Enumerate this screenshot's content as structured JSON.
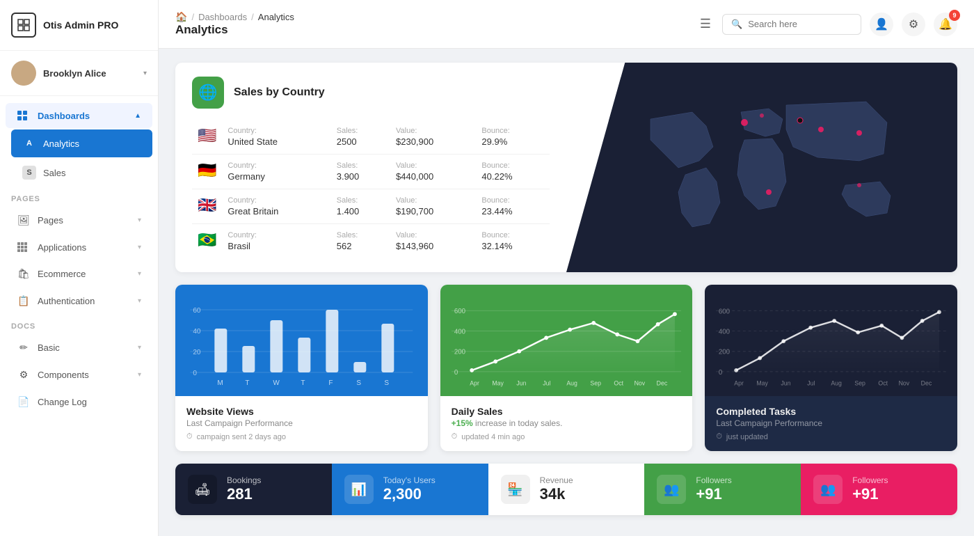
{
  "app": {
    "name": "Otis Admin PRO"
  },
  "user": {
    "name": "Brooklyn Alice"
  },
  "sidebar": {
    "pages_label": "PAGES",
    "docs_label": "DOCS",
    "items": [
      {
        "id": "dashboards",
        "label": "Dashboards",
        "icon": "⊞",
        "active": false,
        "parent": true
      },
      {
        "id": "analytics",
        "label": "Analytics",
        "icon": "A",
        "active": true
      },
      {
        "id": "sales",
        "label": "Sales",
        "icon": "S",
        "active": false
      },
      {
        "id": "pages",
        "label": "Pages",
        "icon": "🖼",
        "active": false
      },
      {
        "id": "applications",
        "label": "Applications",
        "icon": "⊞",
        "active": false
      },
      {
        "id": "ecommerce",
        "label": "Ecommerce",
        "icon": "🛍",
        "active": false
      },
      {
        "id": "authentication",
        "label": "Authentication",
        "icon": "📋",
        "active": false
      },
      {
        "id": "basic",
        "label": "Basic",
        "icon": "✏",
        "active": false
      },
      {
        "id": "components",
        "label": "Components",
        "icon": "⚙",
        "active": false
      },
      {
        "id": "changelog",
        "label": "Change Log",
        "icon": "📄",
        "active": false
      }
    ]
  },
  "header": {
    "breadcrumb": {
      "home": "🏠",
      "dashboards": "Dashboards",
      "analytics": "Analytics"
    },
    "page_title": "Analytics",
    "search_placeholder": "Search here",
    "notification_count": "9"
  },
  "sales_by_country": {
    "title": "Sales by Country",
    "columns": {
      "country_label": "Country:",
      "sales_label": "Sales:",
      "value_label": "Value:",
      "bounce_label": "Bounce:"
    },
    "rows": [
      {
        "flag": "🇺🇸",
        "country": "United State",
        "sales": "2500",
        "value": "$230,900",
        "bounce": "29.9%"
      },
      {
        "flag": "🇩🇪",
        "country": "Germany",
        "sales": "3.900",
        "value": "$440,000",
        "bounce": "40.22%"
      },
      {
        "flag": "🇬🇧",
        "country": "Great Britain",
        "sales": "1.400",
        "value": "$190,700",
        "bounce": "23.44%"
      },
      {
        "flag": "🇧🇷",
        "country": "Brasil",
        "sales": "562",
        "value": "$143,960",
        "bounce": "32.14%"
      }
    ]
  },
  "charts": {
    "website_views": {
      "title": "Website Views",
      "subtitle": "Last Campaign Performance",
      "meta": "campaign sent 2 days ago",
      "bars": [
        40,
        25,
        50,
        30,
        60,
        15,
        45
      ],
      "labels": [
        "M",
        "T",
        "W",
        "T",
        "F",
        "S",
        "S"
      ]
    },
    "daily_sales": {
      "title": "Daily Sales",
      "subtitle": "(+15%) increase in today sales.",
      "meta": "updated 4 min ago",
      "highlight": "+15%",
      "points": [
        10,
        80,
        150,
        280,
        350,
        400,
        320,
        280,
        380,
        500
      ],
      "labels": [
        "Apr",
        "May",
        "Jun",
        "Jul",
        "Aug",
        "Sep",
        "Oct",
        "Nov",
        "Dec"
      ]
    },
    "completed_tasks": {
      "title": "Completed Tasks",
      "subtitle": "Last Campaign Performance",
      "meta": "just updated",
      "points": [
        20,
        100,
        250,
        350,
        420,
        320,
        380,
        300,
        450,
        500
      ],
      "labels": [
        "Apr",
        "May",
        "Jun",
        "Jul",
        "Aug",
        "Sep",
        "Oct",
        "Nov",
        "Dec"
      ]
    }
  },
  "stats": [
    {
      "label": "Bookings",
      "value": "281",
      "icon": "🛋"
    },
    {
      "label": "Today's Users",
      "value": "2,300",
      "icon": "📊"
    },
    {
      "label": "Revenue",
      "value": "34k",
      "icon": "🏪"
    },
    {
      "label": "Followers",
      "value": "+91",
      "icon": "👥"
    }
  ]
}
